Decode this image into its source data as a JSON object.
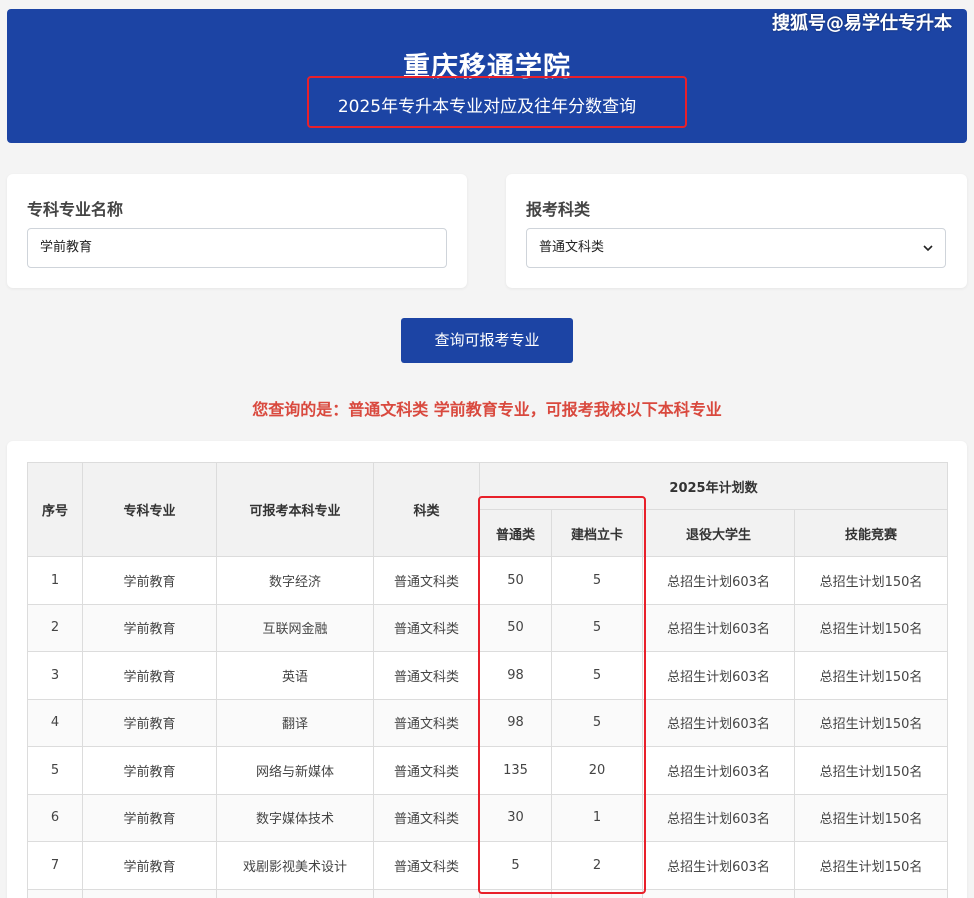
{
  "header": {
    "title": "重庆移通学院",
    "subtitle": "2025年专升本专业对应及往年分数查询"
  },
  "watermark": "搜狐号@易学仕专升本",
  "form": {
    "major_label": "专科专业名称",
    "major_value": "学前教育",
    "category_label": "报考科类",
    "category_value": "普通文科类"
  },
  "query_button": "查询可报考专业",
  "result_text": "您查询的是：普通文科类 学前教育专业，可报考我校以下本科专业",
  "table": {
    "headers": {
      "index": "序号",
      "major": "专科专业",
      "target": "可报考本科专业",
      "category": "科类",
      "plan_group": "2025年计划数",
      "regular": "普通类",
      "archive": "建档立卡",
      "veteran": "退役大学生",
      "skill": "技能竞赛"
    },
    "rows": [
      {
        "no": "1",
        "major": "学前教育",
        "target": "数字经济",
        "category": "普通文科类",
        "regular": "50",
        "archive": "5",
        "veteran": "总招生计划603名",
        "skill": "总招生计划150名"
      },
      {
        "no": "2",
        "major": "学前教育",
        "target": "互联网金融",
        "category": "普通文科类",
        "regular": "50",
        "archive": "5",
        "veteran": "总招生计划603名",
        "skill": "总招生计划150名"
      },
      {
        "no": "3",
        "major": "学前教育",
        "target": "英语",
        "category": "普通文科类",
        "regular": "98",
        "archive": "5",
        "veteran": "总招生计划603名",
        "skill": "总招生计划150名"
      },
      {
        "no": "4",
        "major": "学前教育",
        "target": "翻译",
        "category": "普通文科类",
        "regular": "98",
        "archive": "5",
        "veteran": "总招生计划603名",
        "skill": "总招生计划150名"
      },
      {
        "no": "5",
        "major": "学前教育",
        "target": "网络与新媒体",
        "category": "普通文科类",
        "regular": "135",
        "archive": "20",
        "veteran": "总招生计划603名",
        "skill": "总招生计划150名"
      },
      {
        "no": "6",
        "major": "学前教育",
        "target": "数字媒体技术",
        "category": "普通文科类",
        "regular": "30",
        "archive": "1",
        "veteran": "总招生计划603名",
        "skill": "总招生计划150名"
      },
      {
        "no": "7",
        "major": "学前教育",
        "target": "戏剧影视美术设计",
        "category": "普通文科类",
        "regular": "5",
        "archive": "2",
        "veteran": "总招生计划603名",
        "skill": "总招生计划150名"
      },
      {
        "no": "",
        "major": "",
        "target": "",
        "category": "",
        "regular": "",
        "archive": "",
        "veteran": "",
        "skill": ""
      }
    ]
  },
  "colors": {
    "brand_blue": "#1c44a4",
    "highlight_red": "#e8202a",
    "result_red": "#d9493e"
  }
}
